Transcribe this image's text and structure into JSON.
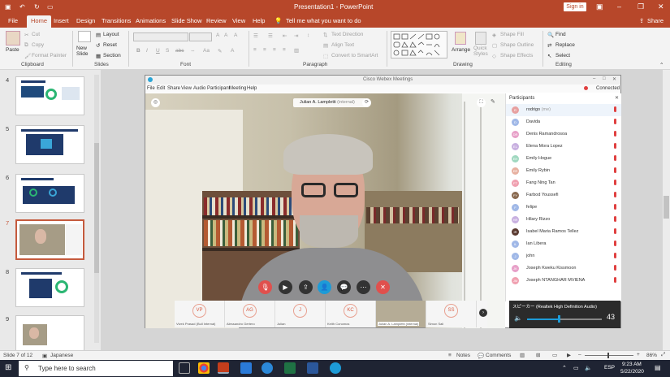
{
  "titlebar": {
    "title": "Presentation1 - PowerPoint",
    "sign_in": "Sign in"
  },
  "tabs": [
    "File",
    "Home",
    "Insert",
    "Design",
    "Transitions",
    "Animations",
    "Slide Show",
    "Review",
    "View",
    "Help"
  ],
  "tell_me": "Tell me what you want to do",
  "share": "Share",
  "ribbon": {
    "clipboard": {
      "paste": "Paste",
      "cut": "Cut",
      "copy": "Copy",
      "format_painter": "Format Painter",
      "label": "Clipboard"
    },
    "slides": {
      "new_slide": "New Slide",
      "layout": "Layout",
      "reset": "Reset",
      "section": "Section",
      "label": "Slides"
    },
    "font": {
      "label": "Font",
      "bold": "B",
      "italic": "I",
      "underline": "U",
      "strike": "S",
      "abc": "abc",
      "size_up": "A",
      "size_down": "A",
      "clear": "A",
      "aa": "Aa",
      "color": "A"
    },
    "paragraph": {
      "text_direction": "Text Direction",
      "align_text": "Align Text",
      "convert_smartart": "Convert to SmartArt",
      "label": "Paragraph"
    },
    "drawing": {
      "arrange": "Arrange",
      "quick_styles": "Quick Styles",
      "shape_fill": "Shape Fill",
      "shape_outline": "Shape Outline",
      "shape_effects": "Shape Effects",
      "label": "Drawing"
    },
    "editing": {
      "find": "Find",
      "replace": "Replace",
      "select": "Select",
      "label": "Editing"
    }
  },
  "slides": [
    {
      "num": "4"
    },
    {
      "num": "5"
    },
    {
      "num": "6"
    },
    {
      "num": "7"
    },
    {
      "num": "8"
    },
    {
      "num": "9"
    }
  ],
  "webex": {
    "title": "Cisco Webex Meetings",
    "menu": [
      "File",
      "Edit",
      "Share",
      "View",
      "Audio",
      "Participant",
      "Meeting",
      "Help"
    ],
    "connected": "Connected",
    "speaker_name": "Julian A. Lampletti",
    "speaker_role": "(internal)",
    "participants_label": "Participants",
    "participants": [
      {
        "initials": "R",
        "name": "rodrigo",
        "extra": "(me)"
      },
      {
        "initials": "D",
        "name": "Davida",
        "extra": ""
      },
      {
        "initials": "DR",
        "name": "Denis Ramandrosoa",
        "extra": ""
      },
      {
        "initials": "EL",
        "name": "Elena Mora Lopez",
        "extra": ""
      },
      {
        "initials": "EH",
        "name": "Emily Hogue",
        "extra": ""
      },
      {
        "initials": "ER",
        "name": "Emily Rybin",
        "extra": ""
      },
      {
        "initials": "FT",
        "name": "Fang Ning Tan",
        "extra": ""
      },
      {
        "initials": "FY",
        "name": "Farbod Youssefi",
        "extra": ""
      },
      {
        "initials": "F",
        "name": "felipe",
        "extra": ""
      },
      {
        "initials": "HR",
        "name": "Hilary Rizzo",
        "extra": ""
      },
      {
        "initials": "IR",
        "name": "Isabel Maria Ramos Tellez",
        "extra": ""
      },
      {
        "initials": "IL",
        "name": "Ian Libera",
        "extra": ""
      },
      {
        "initials": "J",
        "name": "john",
        "extra": ""
      },
      {
        "initials": "JK",
        "name": "Joseph Kweku Kissmoon",
        "extra": ""
      },
      {
        "initials": "JM",
        "name": "Joseph NTANGHAR MVIENA",
        "extra": ""
      }
    ],
    "tiles": [
      {
        "initials": "VP",
        "name": "Vivek Prasad (Bull Internal)"
      },
      {
        "initials": "AG",
        "name": "Alessandro Gertero"
      },
      {
        "initials": "J",
        "name": "Julian"
      },
      {
        "initials": "KC",
        "name": "Keith Conomos"
      },
      {
        "initials": "",
        "name": "Julian A. Lampletti (internal)"
      },
      {
        "initials": "SS",
        "name": "Simon Sali"
      }
    ],
    "audio_label": "スピーカー (Realtek High Definition Audio)",
    "volume": "43"
  },
  "status": {
    "slide_info": "Slide 7 of 12",
    "language": "Japanese",
    "notes": "Notes",
    "comments": "Comments",
    "zoom": "86%"
  },
  "taskbar": {
    "search": "Type here to search",
    "time": "9:23 AM",
    "date": "5/22/2020",
    "lang": "ESP"
  }
}
